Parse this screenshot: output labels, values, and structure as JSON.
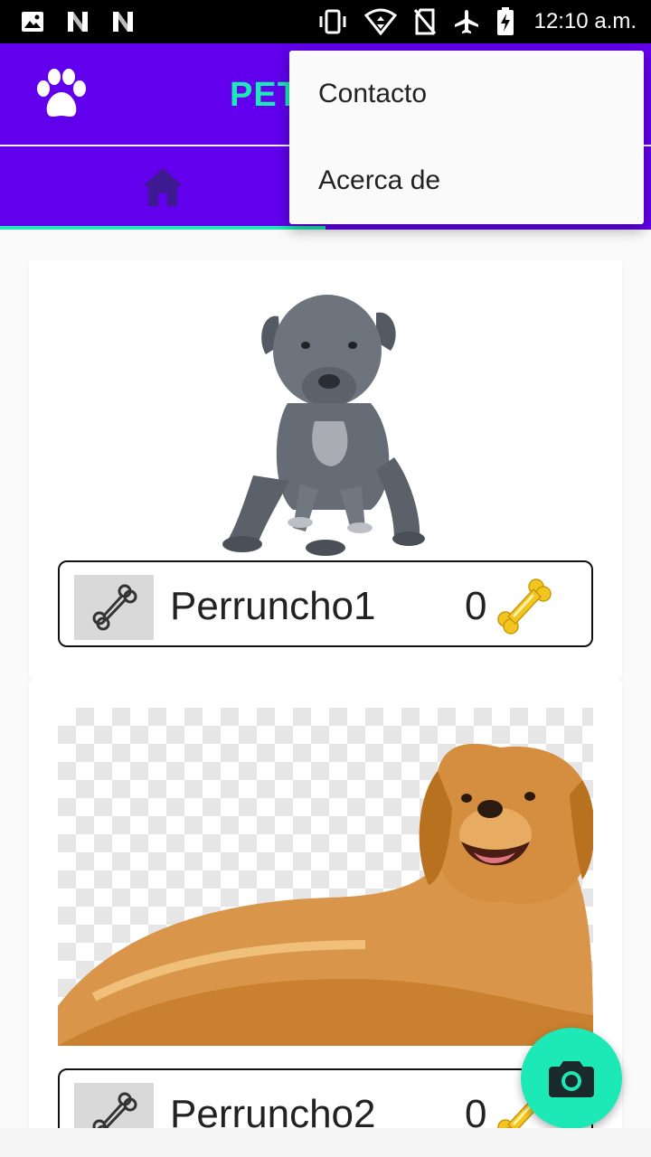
{
  "status_bar": {
    "time": "12:10 a.m.",
    "left_icons": [
      "image-notification-icon",
      "n-notification-icon",
      "n-notification-icon"
    ],
    "right_icons": [
      "vibrate-icon",
      "wifi-icon",
      "no-sim-icon",
      "airplane-mode-icon",
      "battery-charging-icon"
    ]
  },
  "app_bar": {
    "title": "PET",
    "logo_icon": "paw-icon"
  },
  "tabs": [
    {
      "icon": "home-icon",
      "selected": true
    }
  ],
  "menu": {
    "items": [
      "Contacto",
      "Acerca de"
    ]
  },
  "pets": [
    {
      "name": "Perruncho1",
      "likes": "0",
      "photo": "grey-puppy"
    },
    {
      "name": "Perruncho2",
      "likes": "0",
      "photo": "golden-retriever"
    }
  ],
  "fab": {
    "icon": "camera-icon"
  },
  "colors": {
    "primary": "#6200ee",
    "accent": "#1de9b6",
    "status_bar": "#000000",
    "like_button_bg": "#d9d9d9"
  }
}
